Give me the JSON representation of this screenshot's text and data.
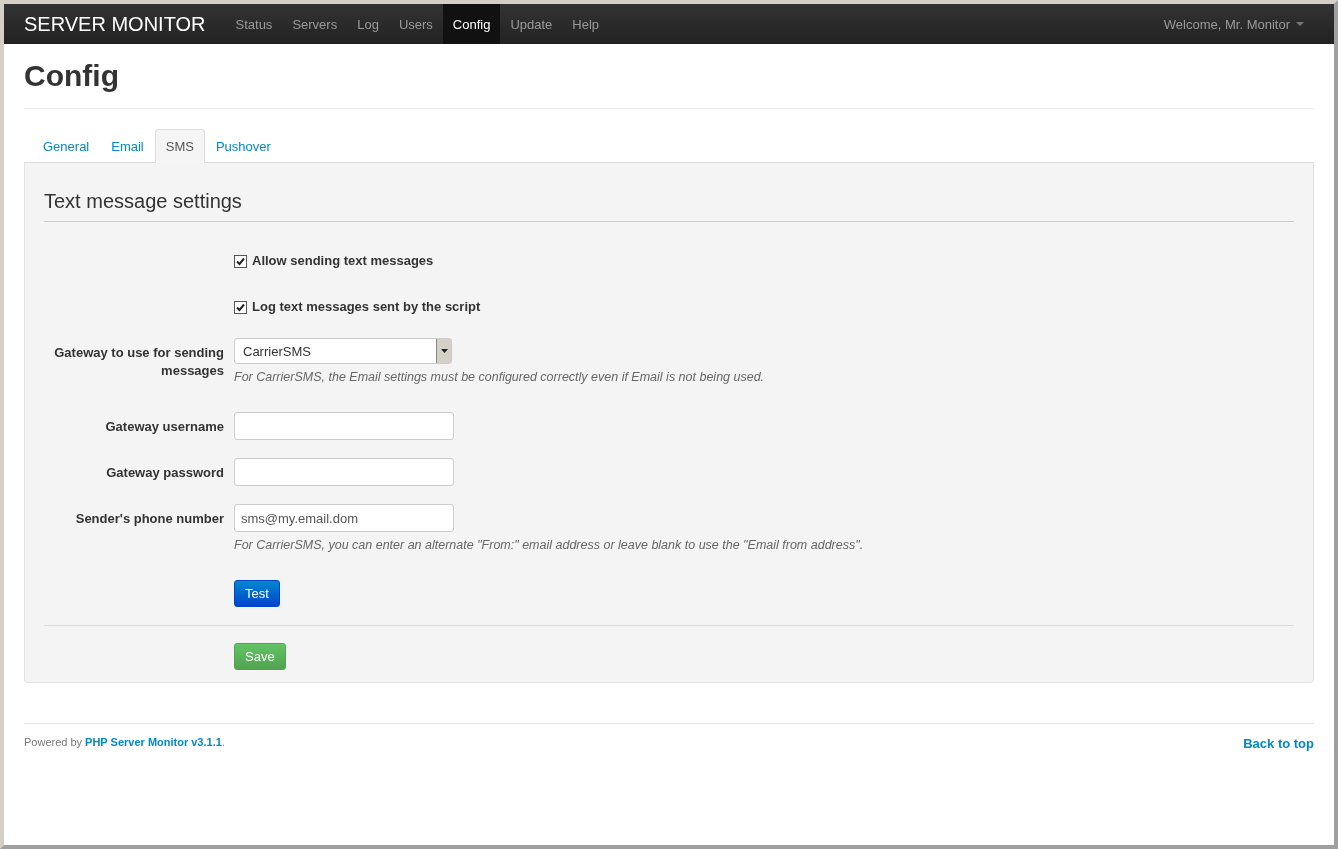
{
  "navbar": {
    "brand": "SERVER MONITOR",
    "items": [
      {
        "label": "Status",
        "selected": false
      },
      {
        "label": "Servers",
        "selected": false
      },
      {
        "label": "Log",
        "selected": false
      },
      {
        "label": "Users",
        "selected": false
      },
      {
        "label": "Config",
        "selected": true
      },
      {
        "label": "Update",
        "selected": false
      },
      {
        "label": "Help",
        "selected": false
      }
    ],
    "user_menu": "Welcome, Mr. Monitor"
  },
  "page_title": "Config",
  "tabs": [
    {
      "label": "General",
      "selected": false
    },
    {
      "label": "Email",
      "selected": false
    },
    {
      "label": "SMS",
      "selected": true
    },
    {
      "label": "Pushover",
      "selected": false
    }
  ],
  "panel": {
    "legend": "Text message settings",
    "fields": [
      {
        "kind": "checkbox",
        "label": "Allow sending text messages",
        "checked": true
      },
      {
        "kind": "checkbox",
        "label": "Log text messages sent by the script",
        "checked": true
      },
      {
        "kind": "select",
        "label": "Gateway to use for sending messages",
        "value": "CarrierSMS",
        "help": "For CarrierSMS, the Email settings must be configured correctly even if Email is not being used."
      },
      {
        "kind": "text",
        "label": "Gateway username"
      },
      {
        "kind": "text",
        "label": "Gateway password"
      },
      {
        "kind": "text",
        "label": "Sender's phone number",
        "value": "sms@my.email.dom",
        "help": "For CarrierSMS, you can enter an alternate \"From:\" email address or leave blank to use the \"Email from address\"."
      },
      {
        "kind": "button",
        "label": "Test"
      }
    ],
    "save_button": "Save"
  },
  "footer": {
    "prefix": "Powered by",
    "link": "PHP Server Monitor v3.1.1",
    "suffix": ".",
    "back_to_top": "Back to top"
  }
}
